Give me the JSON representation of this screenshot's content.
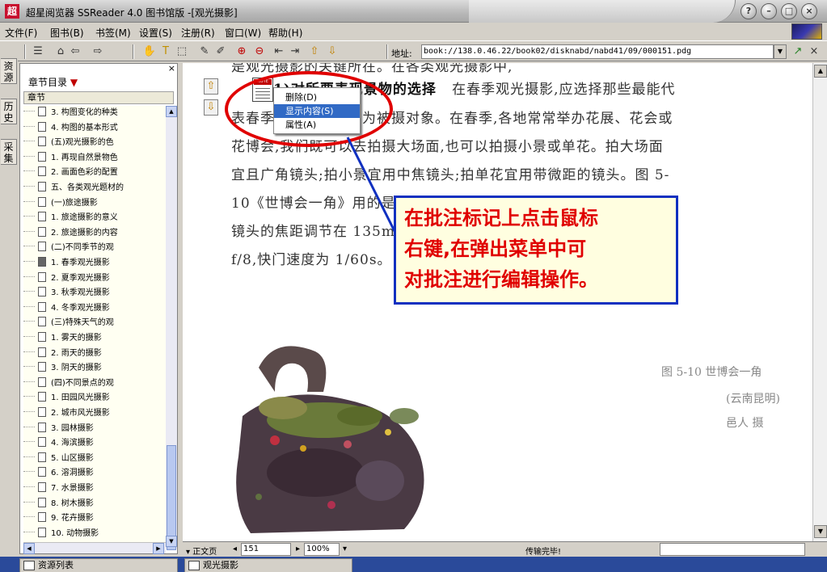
{
  "window": {
    "logo_glyph": "超",
    "title": "超星阅览器 SSReader 4.0 图书馆版 -[观光摄影]",
    "buttons": [
      "?",
      "–",
      "□",
      "×"
    ]
  },
  "menu": {
    "items": [
      "文件(F)",
      "图书(B)",
      "书签(M)",
      "设置(S)",
      "注册(R)",
      "窗口(W)",
      "帮助(H)"
    ]
  },
  "toolbar": {
    "address_label": "地址:",
    "address_value": "book://138.0.46.22/book02/disknabd/nabd41/09/000151.pdg"
  },
  "vertical_tabs": [
    "资源",
    "历史",
    "采集"
  ],
  "sidebar": {
    "close": "×",
    "heading": "章节目录",
    "heading_arrow": "▼",
    "column_header": "章节",
    "items": [
      "3. 构图变化的种类",
      "4. 构图的基本形式",
      "(五)观光摄影的色",
      "1. 再现自然景物色",
      "2. 画面色彩的配置",
      "五、各类观光题材的",
      "(一)旅途摄影",
      "1. 旅途摄影的意义",
      "2. 旅途摄影的内容",
      "(二)不同季节的观",
      "1. 春季观光摄影",
      "2. 夏季观光摄影",
      "3. 秋季观光摄影",
      "4. 冬季观光摄影",
      "(三)特殊天气的观",
      "1. 雾天的摄影",
      "2. 雨天的摄影",
      "3. 阴天的摄影",
      "(四)不同景点的观",
      "1. 田园风光摄影",
      "2. 城市风光摄影",
      "3. 园林摄影",
      "4. 海滨摄影",
      "5. 山区摄影",
      "6. 溶洞摄影",
      "7. 水景摄影",
      "8. 树木摄影",
      "9. 花卉摄影",
      "10. 动物摄影"
    ],
    "active_index": 10
  },
  "document": {
    "top_fragment": "是观光摄影的关键所在。在各类观光摄影中,",
    "lead_bold": "1)对所要表现景物的选择",
    "line1_rest": "在春季观光摄影,应选择那些最能代",
    "line2": "表春季特征的景物作为被摄对象。在春季,各地常常举办花展、花会或",
    "line3": "花博会,我们既可以去拍摄大场面,也可以拍摄小景或单花。拍大场面",
    "line4": "宜且广角镜头;拍小景宜用中焦镜头;拍单花宜用带微距的镜头。图 5-",
    "line5": "10《世博会一角》用的是的佳能 EOS-5 型单镜头反光照相机,拍摄时",
    "line6": "镜头的焦距调节在 135mm,使用ISO100胶卷,光圈系数为",
    "line7": "f/8,快门速度为 1/60s。",
    "caption_lines": [
      "图 5-10  世博会一角",
      "(云南昆明)",
      "邑人 摄"
    ]
  },
  "note_marker": {
    "tag": "NOTE"
  },
  "context_menu": {
    "items": [
      "删除(D)",
      "显示内容(S)",
      "属性(A)"
    ],
    "selected_index": 1
  },
  "callout": {
    "lines": [
      "在批注标记上点击鼠标",
      "右键,在弹出菜单中可",
      "对批注进行编辑操作。"
    ]
  },
  "statusbar": {
    "view_mode": "正文页",
    "page_number": "151",
    "zoom": "100%",
    "status_text": "传输完毕!"
  },
  "bottom_tabs": [
    "资源列表",
    "观光摄影"
  ],
  "colors": {
    "annotation_red": "#e00000",
    "callout_border": "#1030c0",
    "menu_selection": "#316ac5"
  }
}
